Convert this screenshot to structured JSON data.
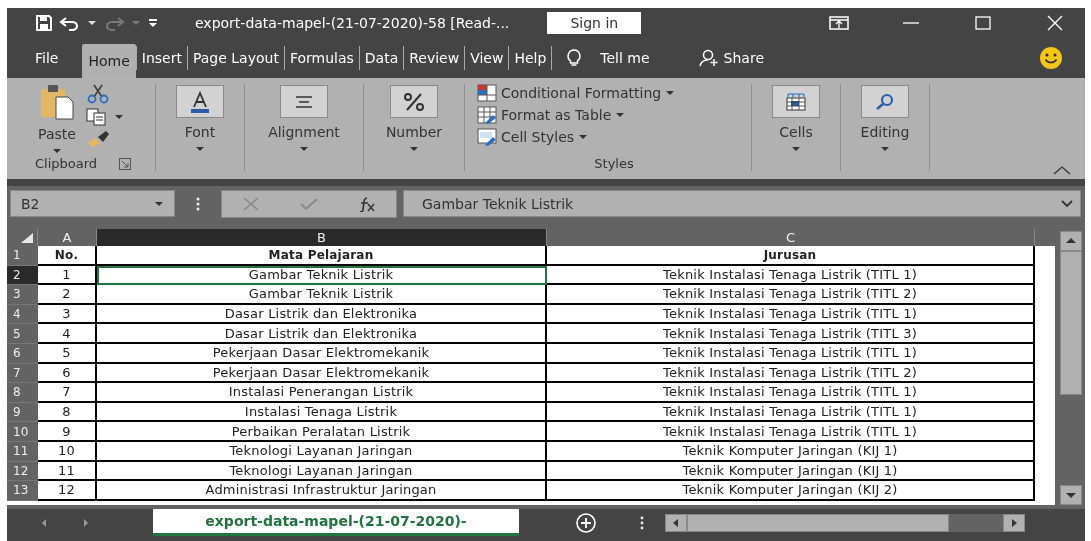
{
  "title_bar": {
    "title": "export-data-mapel-(21-07-2020)-58  [Read-...",
    "sign_in": "Sign in"
  },
  "menu_tabs": [
    {
      "label": "File",
      "selected": false
    },
    {
      "label": "Home",
      "selected": true
    },
    {
      "label": "Insert",
      "selected": false
    },
    {
      "label": "Page Layout",
      "selected": false
    },
    {
      "label": "Formulas",
      "selected": false
    },
    {
      "label": "Data",
      "selected": false
    },
    {
      "label": "Review",
      "selected": false
    },
    {
      "label": "View",
      "selected": false
    },
    {
      "label": "Help",
      "selected": false
    }
  ],
  "tell_me": "Tell me",
  "share": "Share",
  "ribbon": {
    "paste": "Paste",
    "clipboard": "Clipboard",
    "font": "Font",
    "alignment": "Alignment",
    "number": "Number",
    "styles": [
      "Conditional Formatting",
      "Format as Table",
      "Cell Styles"
    ],
    "styles_label": "Styles",
    "cells": "Cells",
    "editing": "Editing"
  },
  "formula_bar": {
    "name_box": "B2",
    "formula": "Gambar Teknik Listrik"
  },
  "columns": [
    {
      "label": "A",
      "selected": false
    },
    {
      "label": "B",
      "selected": true
    },
    {
      "label": "C",
      "selected": false
    }
  ],
  "rows": [
    {
      "number": "1",
      "kind": "header",
      "selected": false,
      "cells": [
        "No.",
        "Mata Pelajaran",
        "Jurusan"
      ]
    },
    {
      "number": "2",
      "kind": "data",
      "selected": true,
      "cells": [
        "1",
        "Gambar Teknik Listrik",
        "Teknik Instalasi Tenaga Listrik (TITL 1)"
      ]
    },
    {
      "number": "3",
      "kind": "data",
      "selected": false,
      "cells": [
        "2",
        "Gambar Teknik Listrik",
        "Teknik Instalasi Tenaga Listrik (TITL 2)"
      ]
    },
    {
      "number": "4",
      "kind": "data",
      "selected": false,
      "cells": [
        "3",
        "Dasar Listrik dan Elektronika",
        "Teknik Instalasi Tenaga Listrik (TITL 1)"
      ]
    },
    {
      "number": "5",
      "kind": "data",
      "selected": false,
      "cells": [
        "4",
        "Dasar Listrik dan Elektronika",
        "Teknik Instalasi Tenaga Listrik (TITL 3)"
      ]
    },
    {
      "number": "6",
      "kind": "data",
      "selected": false,
      "cells": [
        "5",
        "Pekerjaan Dasar Elektromekanik",
        "Teknik Instalasi Tenaga Listrik (TITL 1)"
      ]
    },
    {
      "number": "7",
      "kind": "data",
      "selected": false,
      "cells": [
        "6",
        "Pekerjaan Dasar Elektromekanik",
        "Teknik Instalasi Tenaga Listrik (TITL 2)"
      ]
    },
    {
      "number": "8",
      "kind": "data",
      "selected": false,
      "cells": [
        "7",
        "Instalasi Penerangan Listrik",
        "Teknik Instalasi Tenaga Listrik (TITL 1)"
      ]
    },
    {
      "number": "9",
      "kind": "data",
      "selected": false,
      "cells": [
        "8",
        "Instalasi Tenaga Listrik",
        "Teknik Instalasi Tenaga Listrik (TITL 1)"
      ]
    },
    {
      "number": "10",
      "kind": "data",
      "selected": false,
      "cells": [
        "9",
        "Perbaikan Peralatan Listrik",
        "Teknik Instalasi Tenaga Listrik (TITL 1)"
      ]
    },
    {
      "number": "11",
      "kind": "data",
      "selected": false,
      "cells": [
        "10",
        "Teknologi Layanan Jaringan",
        "Teknik Komputer Jaringan (KIJ 1)"
      ]
    },
    {
      "number": "12",
      "kind": "data",
      "selected": false,
      "cells": [
        "11",
        "Teknologi Layanan Jaringan",
        "Teknik Komputer Jaringan (KIJ 1)"
      ]
    },
    {
      "number": "13",
      "kind": "data",
      "selected": false,
      "cells": [
        "12",
        "Administrasi Infrastruktur Jaringan",
        "Teknik Komputer Jaringan (KIJ 2)"
      ]
    }
  ],
  "sheet_tabs": [
    {
      "label": "export-data-mapel-(21-07-2020)-",
      "selected": true
    }
  ]
}
